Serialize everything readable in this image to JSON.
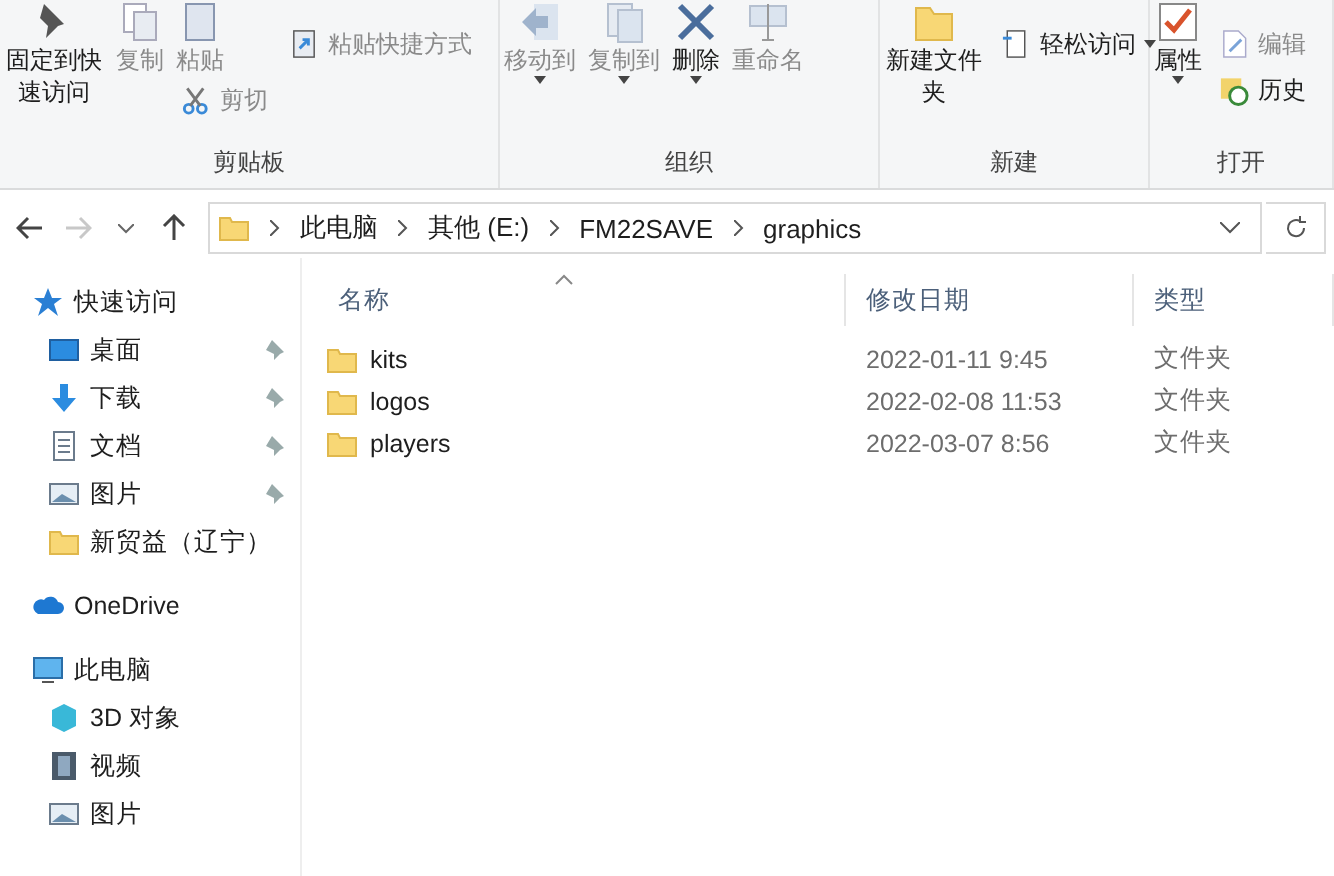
{
  "ribbon": {
    "groups": [
      {
        "label": "剪贴板",
        "columns": [
          [
            {
              "kind": "large",
              "label": "固定到快速访问",
              "disabled": false,
              "dropdown": false
            }
          ],
          [
            {
              "kind": "large",
              "label": "复制",
              "disabled": true,
              "dropdown": false
            }
          ],
          [
            {
              "kind": "large",
              "label": "粘贴",
              "disabled": true,
              "dropdown": false
            },
            {
              "kind": "small",
              "label": "剪切",
              "disabled": true,
              "dropdown": false
            }
          ],
          [
            {
              "kind": "small",
              "label": "粘贴快捷方式",
              "disabled": true,
              "dropdown": false
            }
          ]
        ]
      },
      {
        "label": "组织",
        "columns": [
          [
            {
              "kind": "large",
              "label": "移动到",
              "disabled": true,
              "dropdown": true
            }
          ],
          [
            {
              "kind": "large",
              "label": "复制到",
              "disabled": true,
              "dropdown": true
            }
          ],
          [
            {
              "kind": "large",
              "label": "删除",
              "disabled": false,
              "dropdown": true
            }
          ],
          [
            {
              "kind": "large",
              "label": "重命名",
              "disabled": true,
              "dropdown": false
            }
          ]
        ]
      },
      {
        "label": "新建",
        "columns": [
          [
            {
              "kind": "large",
              "label": "新建文件夹",
              "disabled": false,
              "dropdown": false
            }
          ],
          [
            {
              "kind": "small",
              "label": "轻松访问",
              "disabled": false,
              "dropdown": true
            }
          ]
        ]
      },
      {
        "label": "打开",
        "columns": [
          [
            {
              "kind": "large",
              "label": "属性",
              "disabled": false,
              "dropdown": true
            }
          ],
          [
            {
              "kind": "small",
              "label": "编辑",
              "disabled": true,
              "dropdown": false
            },
            {
              "kind": "small",
              "label": "历史",
              "disabled": false,
              "dropdown": false
            }
          ]
        ]
      }
    ]
  },
  "nav": {
    "back_disabled": false,
    "forward_disabled": true
  },
  "address": {
    "segments": [
      "此电脑",
      "其他 (E:)",
      "FM22SAVE",
      "graphics"
    ]
  },
  "sidebar": {
    "items": [
      {
        "label": "快速访问",
        "children": [
          {
            "label": "桌面",
            "pinned": true
          },
          {
            "label": "下载",
            "pinned": true
          },
          {
            "label": "文档",
            "pinned": true
          },
          {
            "label": "图片",
            "pinned": true
          },
          {
            "label": "新贸益（辽宁）",
            "pinned": false
          }
        ]
      },
      {
        "label": "OneDrive"
      },
      {
        "label": "此电脑",
        "children": [
          {
            "label": "3D 对象",
            "pinned": false
          },
          {
            "label": "视频",
            "pinned": false
          },
          {
            "label": "图片",
            "pinned": false
          }
        ]
      }
    ]
  },
  "table": {
    "columns": [
      {
        "label": "名称",
        "sorted": true
      },
      {
        "label": "修改日期",
        "sorted": false
      },
      {
        "label": "类型",
        "sorted": false
      }
    ],
    "rows": [
      {
        "name": "kits",
        "date": "2022-01-11 9:45",
        "type": "文件夹"
      },
      {
        "name": "logos",
        "date": "2022-02-08 11:53",
        "type": "文件夹"
      },
      {
        "name": "players",
        "date": "2022-03-07 8:56",
        "type": "文件夹"
      }
    ]
  }
}
